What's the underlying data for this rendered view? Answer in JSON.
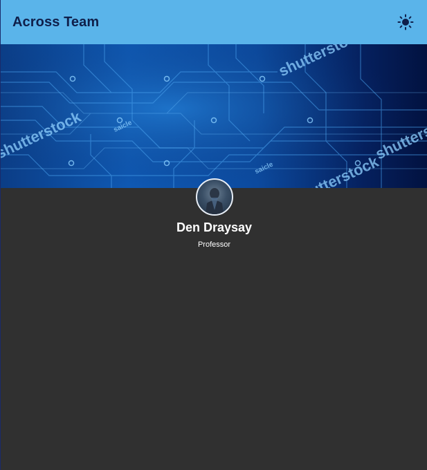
{
  "app": {
    "title": "Across Team",
    "theme_icon": "sun-icon"
  },
  "banner": {
    "watermarks": [
      "shutterstock",
      "shutterstock",
      "shutterstock",
      "shutterstock"
    ],
    "small_labels": [
      "saicle",
      "saicle"
    ]
  },
  "profile": {
    "name": "Den Draysay",
    "role": "Professor"
  },
  "colors": {
    "appbar": "#5ab4ea",
    "title_text": "#0f1f4a",
    "background": "#303030",
    "banner_dark": "#021240",
    "banner_light": "#0f59b3"
  }
}
